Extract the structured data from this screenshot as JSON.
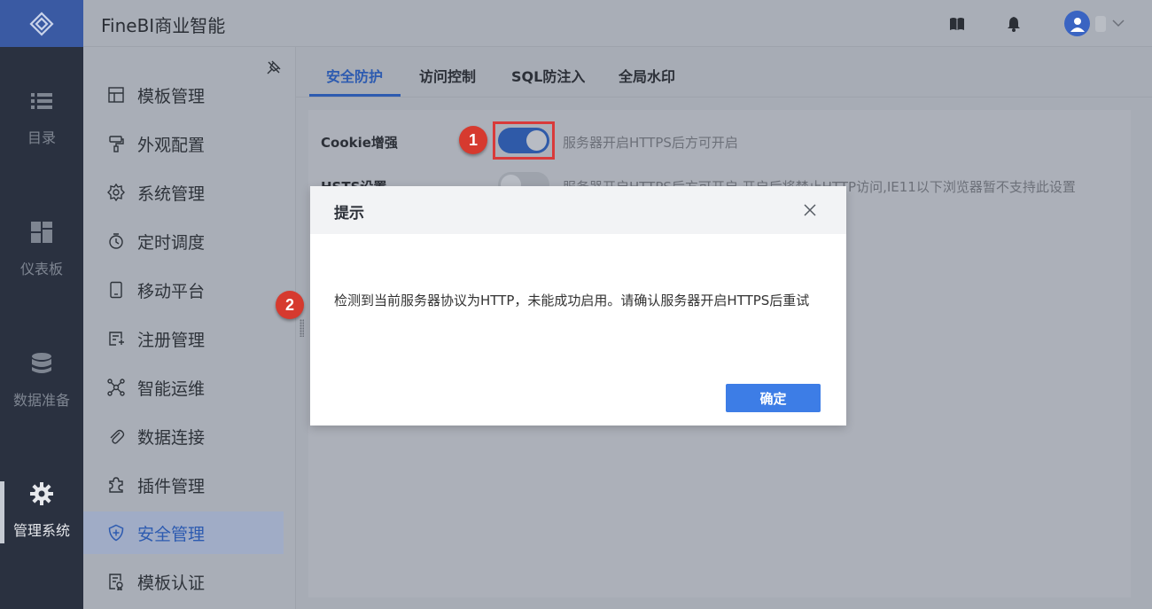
{
  "app": {
    "title": "FineBI商业智能"
  },
  "rail": {
    "items": [
      {
        "label": "目录",
        "icon": "list-icon"
      },
      {
        "label": "仪表板",
        "icon": "dashboard-icon"
      },
      {
        "label": "数据准备",
        "icon": "database-icon"
      },
      {
        "label": "管理系统",
        "icon": "gear-icon",
        "active": true
      }
    ]
  },
  "subnav": {
    "items": [
      {
        "label": "模板管理",
        "icon": "template-icon"
      },
      {
        "label": "外观配置",
        "icon": "paint-roller-icon"
      },
      {
        "label": "系统管理",
        "icon": "settings-icon"
      },
      {
        "label": "定时调度",
        "icon": "timer-icon"
      },
      {
        "label": "移动平台",
        "icon": "mobile-icon"
      },
      {
        "label": "注册管理",
        "icon": "register-icon"
      },
      {
        "label": "智能运维",
        "icon": "network-icon"
      },
      {
        "label": "数据连接",
        "icon": "paperclip-icon"
      },
      {
        "label": "插件管理",
        "icon": "puzzle-icon"
      },
      {
        "label": "安全管理",
        "icon": "shield-icon",
        "active": true
      },
      {
        "label": "模板认证",
        "icon": "certificate-icon"
      }
    ]
  },
  "tabs": [
    {
      "label": "安全防护",
      "active": true
    },
    {
      "label": "访问控制"
    },
    {
      "label": "SQL防注入"
    },
    {
      "label": "全局水印"
    }
  ],
  "settings": {
    "cookie": {
      "label": "Cookie增强",
      "hint": "服务器开启HTTPS后方可开启",
      "enabled": true
    },
    "hsts": {
      "label": "HSTS设置",
      "hint": "服务器开启HTTPS后方可开启,开启后将禁止HTTP访问,IE11以下浏览器暂不支持此设置",
      "enabled": false
    }
  },
  "annotations": {
    "badge1": "1",
    "badge2": "2"
  },
  "dialog": {
    "title": "提示",
    "message": "检测到当前服务器协议为HTTP，未能成功启用。请确认服务器开启HTTPS后重试",
    "confirm": "确定"
  },
  "colors": {
    "accent": "#2d5bb0",
    "button": "#3d7de6",
    "annotation": "#d63a2f"
  }
}
